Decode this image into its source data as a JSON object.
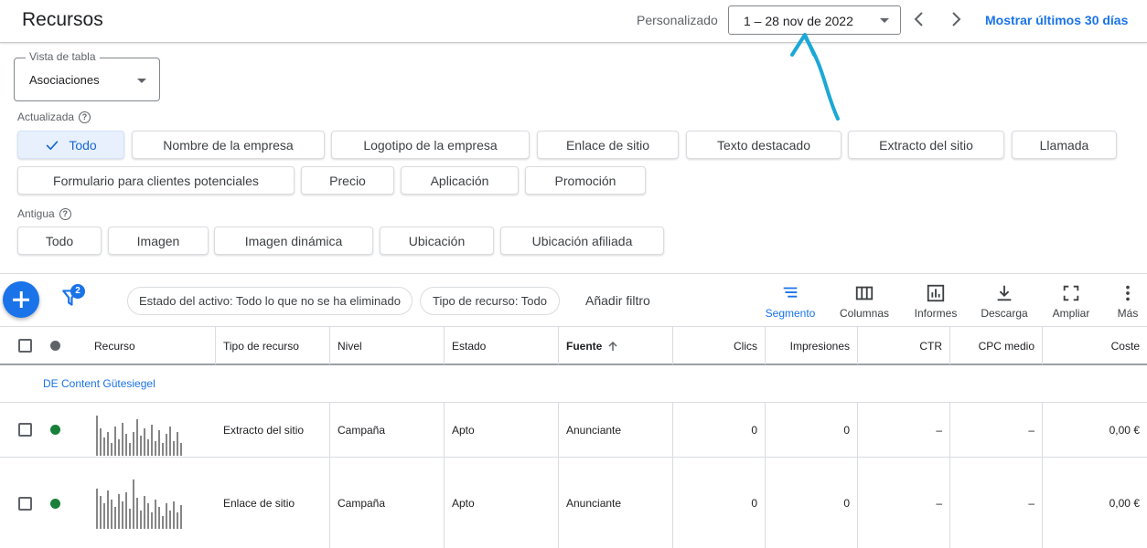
{
  "header": {
    "title": "Recursos",
    "date_label": "Personalizado",
    "date_range": "1 – 28 nov de 2022",
    "show_last": "Mostrar últimos 30 días"
  },
  "table_view": {
    "legend": "Vista de tabla",
    "value": "Asociaciones"
  },
  "updated": {
    "label": "Actualizada",
    "chips": [
      "Todo",
      "Nombre de la empresa",
      "Logotipo de la empresa",
      "Enlace de sitio",
      "Texto destacado",
      "Extracto del sitio",
      "Llamada",
      "Formulario para clientes potenciales",
      "Precio",
      "Aplicación",
      "Promoción"
    ],
    "selected": "Todo"
  },
  "legacy": {
    "label": "Antigua",
    "chips": [
      "Todo",
      "Imagen",
      "Imagen dinámica",
      "Ubicación",
      "Ubicación afiliada"
    ]
  },
  "toolbar": {
    "filter_count": "2",
    "filters": [
      "Estado del activo: Todo lo que no se ha eliminado",
      "Tipo de recurso: Todo"
    ],
    "add_filter": "Añadir filtro",
    "tools": [
      "Segmento",
      "Columnas",
      "Informes",
      "Descarga",
      "Ampliar",
      "Más"
    ]
  },
  "table": {
    "columns": [
      "Recurso",
      "Tipo de recurso",
      "Nivel",
      "Estado",
      "Fuente",
      "Clics",
      "Impresiones",
      "CTR",
      "CPC medio",
      "Coste"
    ],
    "group": "DE Content Gütesiegel",
    "rows": [
      {
        "type": "Extracto del sitio",
        "level": "Campaña",
        "status": "Apto",
        "source": "Anunciante",
        "clicks": "0",
        "impressions": "0",
        "ctr": "–",
        "cpc": "–",
        "cost": "0,00 €"
      },
      {
        "type": "Enlace de sitio",
        "level": "Campaña",
        "status": "Apto",
        "source": "Anunciante",
        "clicks": "0",
        "impressions": "0",
        "ctr": "–",
        "cpc": "–",
        "cost": "0,00 €"
      }
    ]
  },
  "colors": {
    "accent": "#1a73e8",
    "status_ok": "#188038",
    "annotation": "#1ba8d6"
  }
}
